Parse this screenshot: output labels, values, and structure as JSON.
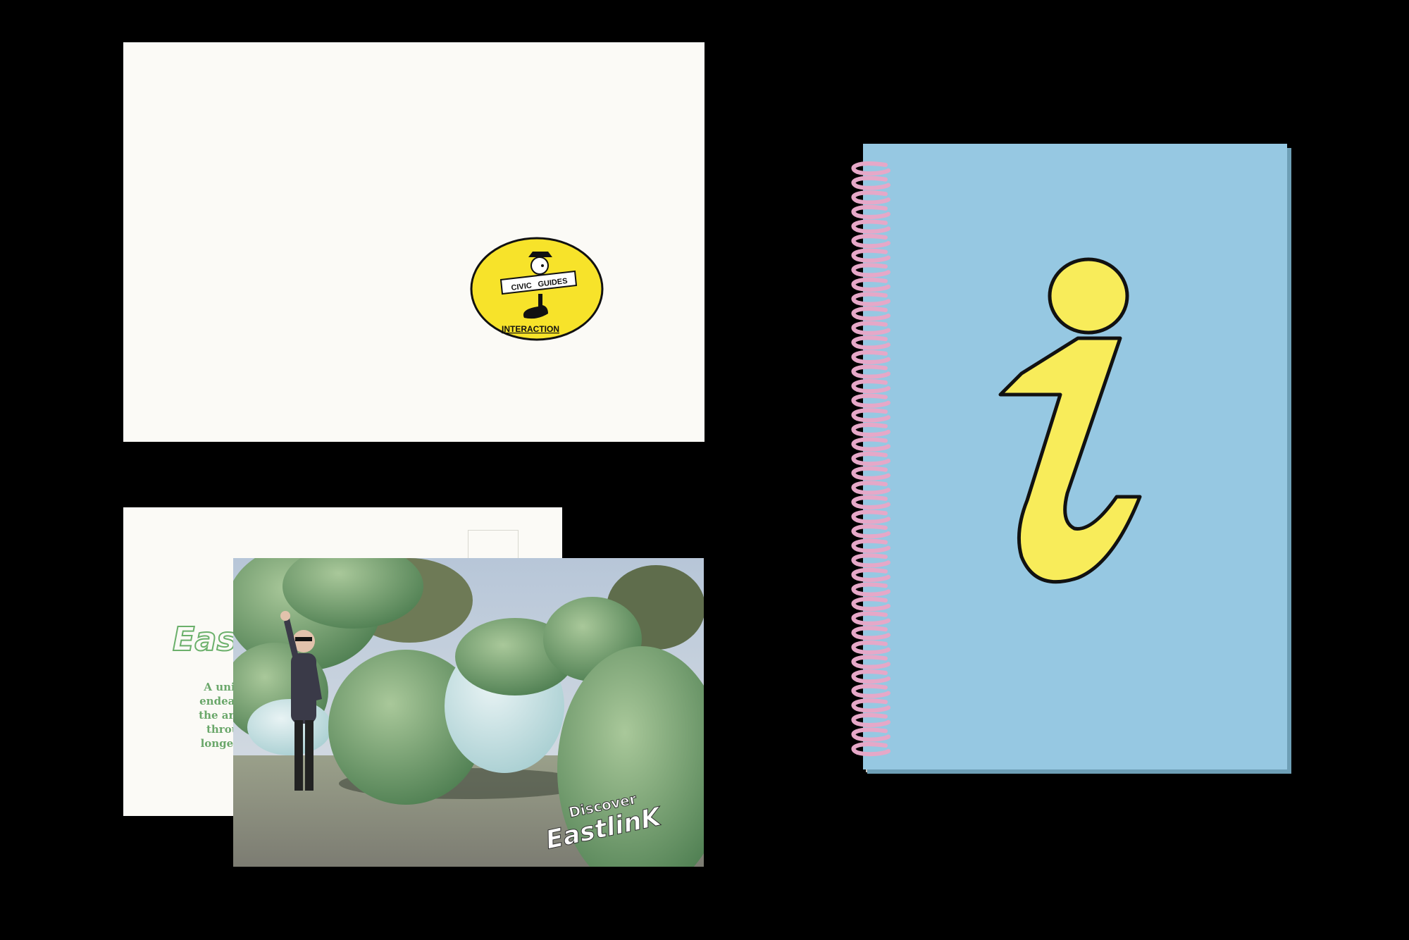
{
  "logo": {
    "banner_left": "CIVIC",
    "banner_right": "GUIDES",
    "caption": "INTERACTION",
    "badge_color": "#f7e32a"
  },
  "postcard_back": {
    "title": "Eastlink",
    "lines": [
      "A unique",
      "endeavour",
      "the arts ac",
      "through",
      "longest sc"
    ]
  },
  "photo_card": {
    "discover_top": "Discover",
    "discover_bottom": "EastlinK"
  },
  "notebook": {
    "cover_color": "#96c8e2",
    "icon": "info-i-icon",
    "icon_color": "#f8ec5a",
    "spiral_color": "#e6a8c8"
  }
}
